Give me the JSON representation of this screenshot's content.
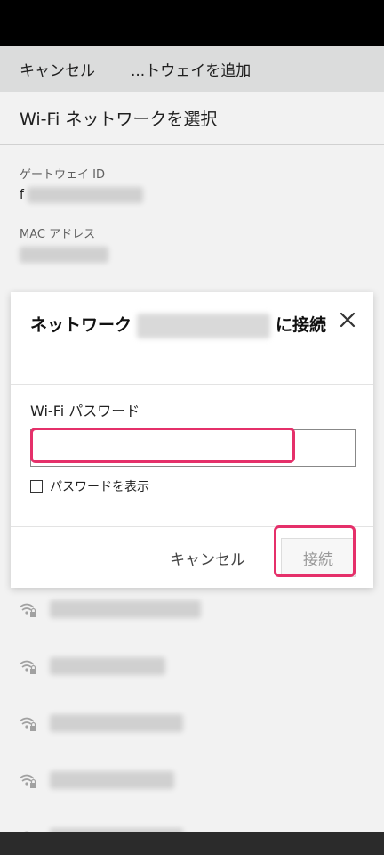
{
  "header": {
    "cancel_label": "キャンセル",
    "title": "...トウェイを追加"
  },
  "subtitle": "Wi-Fi ネットワークを選択",
  "gateway": {
    "label": "ゲートウェイ ID",
    "value_prefix": "f"
  },
  "mac": {
    "label": "MAC アドレス"
  },
  "dialog": {
    "title_prefix": "ネットワーク",
    "title_suffix": "に接続",
    "password_label": "Wi-Fi パスワード",
    "password_value": "",
    "show_password_label": "パスワードを表示",
    "show_password_checked": false,
    "cancel_label": "キャンセル",
    "connect_label": "接続"
  },
  "colors": {
    "highlight": "#e5306a",
    "header_bg": "#e7e8e8"
  },
  "wifi_networks": [
    {
      "icon": "wifi-lock-icon"
    },
    {
      "icon": "wifi-lock-icon"
    },
    {
      "icon": "wifi-lock-icon"
    },
    {
      "icon": "wifi-lock-icon"
    },
    {
      "icon": "wifi-lock-icon"
    }
  ]
}
